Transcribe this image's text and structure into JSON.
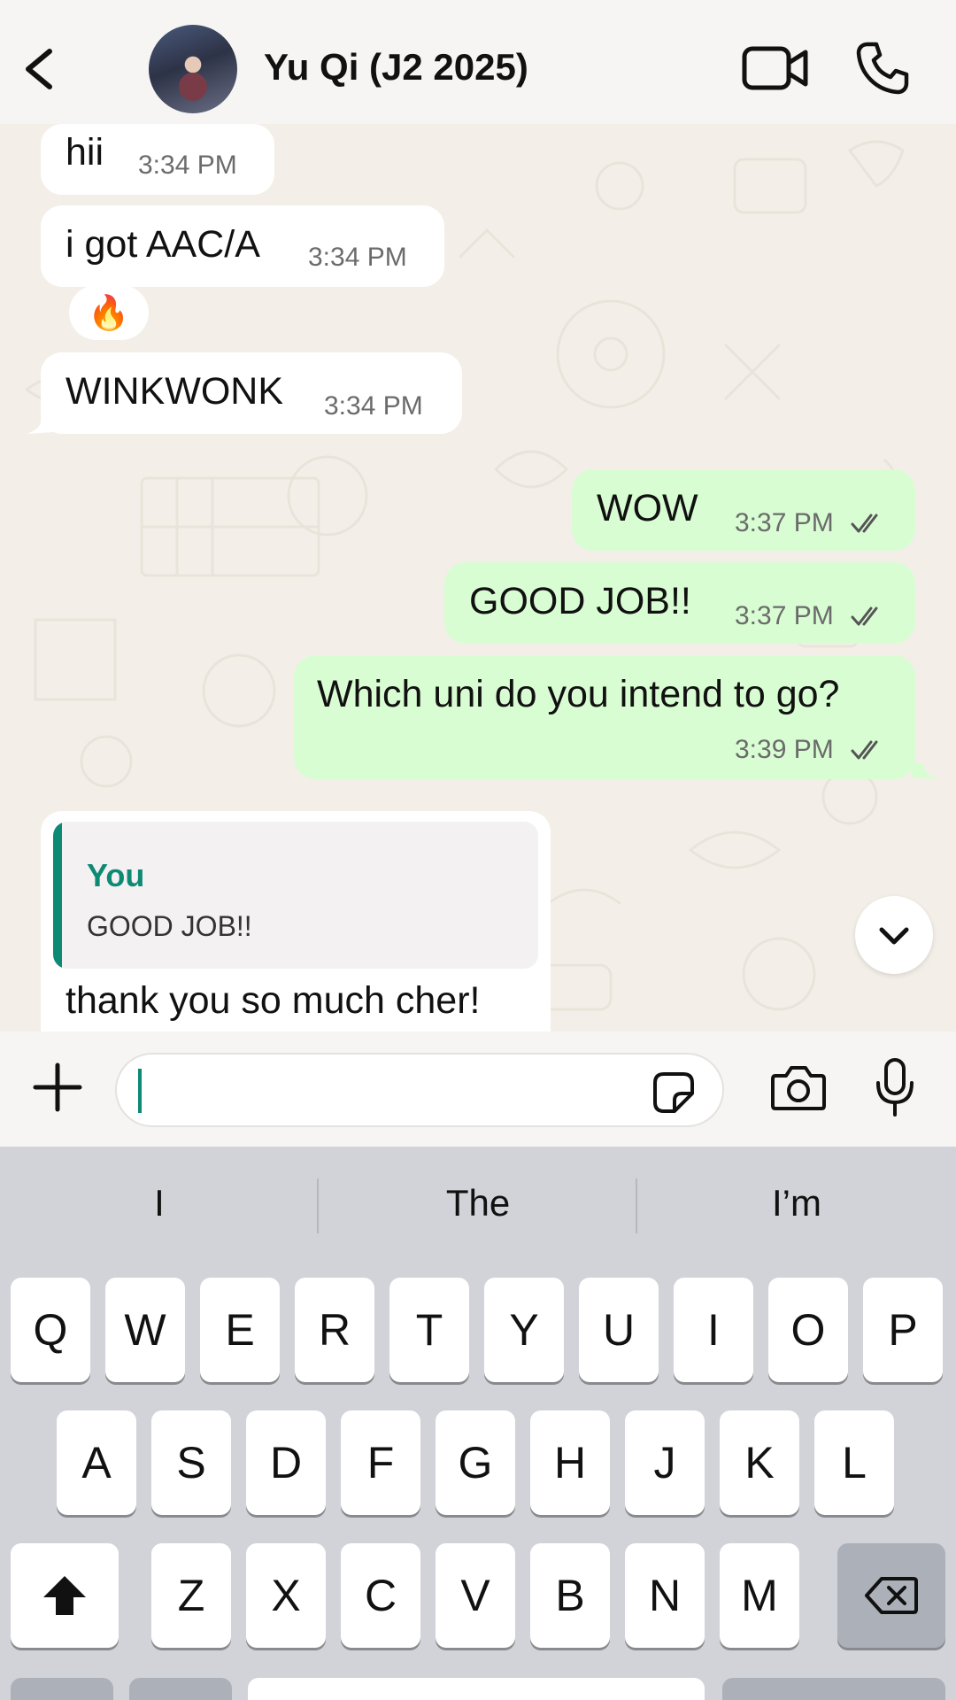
{
  "header": {
    "title": "Yu Qi (J2 2025)"
  },
  "messages": [
    {
      "direction": "incoming",
      "text": "hii",
      "time": "3:34 PM"
    },
    {
      "direction": "incoming",
      "text": "i got AAC/A",
      "time": "3:34 PM",
      "reaction": "🔥"
    },
    {
      "direction": "incoming",
      "text": "WINKWONK",
      "time": "3:34 PM"
    },
    {
      "direction": "outgoing",
      "text": "WOW",
      "time": "3:37 PM",
      "status": "read"
    },
    {
      "direction": "outgoing",
      "text": "GOOD JOB!!",
      "time": "3:37 PM",
      "status": "read"
    },
    {
      "direction": "outgoing",
      "text": "Which uni do you intend to go?",
      "time": "3:39 PM",
      "status": "read"
    },
    {
      "direction": "incoming",
      "text": "thank you so much cher!",
      "reply": {
        "author": "You",
        "quote": "GOOD JOB!!"
      }
    }
  ],
  "composer": {
    "value": "",
    "placeholder": ""
  },
  "keyboard": {
    "suggestions": [
      "I",
      "The",
      "I’m"
    ],
    "row1": [
      "Q",
      "W",
      "E",
      "R",
      "T",
      "Y",
      "U",
      "I",
      "O",
      "P"
    ],
    "row2": [
      "A",
      "S",
      "D",
      "F",
      "G",
      "H",
      "J",
      "K",
      "L"
    ],
    "row3": [
      "Z",
      "X",
      "C",
      "V",
      "B",
      "N",
      "M"
    ]
  },
  "icons": {
    "back": "chevron-left-icon",
    "video": "video-camera-icon",
    "call": "phone-icon",
    "plus": "plus-icon",
    "sticker": "sticker-icon",
    "camera": "camera-icon",
    "mic": "microphone-icon",
    "scroll": "chevron-down-icon",
    "shift": "shift-arrow-icon",
    "backspace": "backspace-icon"
  },
  "colors": {
    "outgoing_bubble": "#d9fdd3",
    "incoming_bubble": "#ffffff",
    "accent": "#0e8a74",
    "keyboard_bg": "#d1d3d9"
  }
}
